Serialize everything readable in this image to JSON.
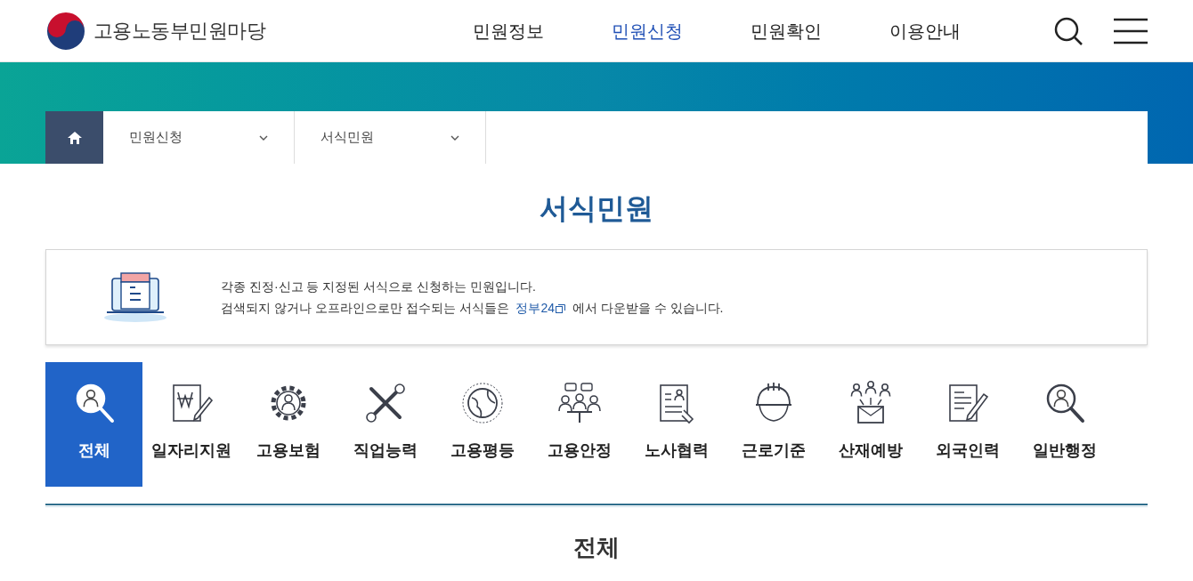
{
  "header": {
    "logo_text": "고용노동부민원마당",
    "nav": [
      {
        "label": "민원정보",
        "selected": false
      },
      {
        "label": "민원신청",
        "selected": true
      },
      {
        "label": "민원확인",
        "selected": false
      },
      {
        "label": "이용안내",
        "selected": false
      }
    ]
  },
  "breadcrumb": [
    {
      "label": "민원신청"
    },
    {
      "label": "서식민원"
    }
  ],
  "page_title": "서식민원",
  "intro": {
    "line1": "각종 진정·신고 등 지정된 서식으로 신청하는 민원입니다.",
    "line2_before": "검색되지 않거나 오프라인으로만 접수되는 서식들은",
    "link": "정부24",
    "line2_after": "에서 다운받을 수 있습니다."
  },
  "categories": [
    {
      "label": "전체",
      "kind": "magnifier",
      "selected": true
    },
    {
      "label": "일자리지원",
      "kind": "won",
      "selected": false
    },
    {
      "label": "고용보험",
      "kind": "gear",
      "selected": false
    },
    {
      "label": "직업능력",
      "kind": "tools",
      "selected": false
    },
    {
      "label": "고용평등",
      "kind": "globe",
      "selected": false
    },
    {
      "label": "고용안정",
      "kind": "meeting",
      "selected": false
    },
    {
      "label": "노사협력",
      "kind": "document",
      "selected": false
    },
    {
      "label": "근로기준",
      "kind": "helmet",
      "selected": false
    },
    {
      "label": "산재예방",
      "kind": "envelope",
      "selected": false
    },
    {
      "label": "외국인력",
      "kind": "pen",
      "selected": false
    },
    {
      "label": "일반행정",
      "kind": "magnifier",
      "selected": false
    }
  ],
  "section_title": "전체"
}
